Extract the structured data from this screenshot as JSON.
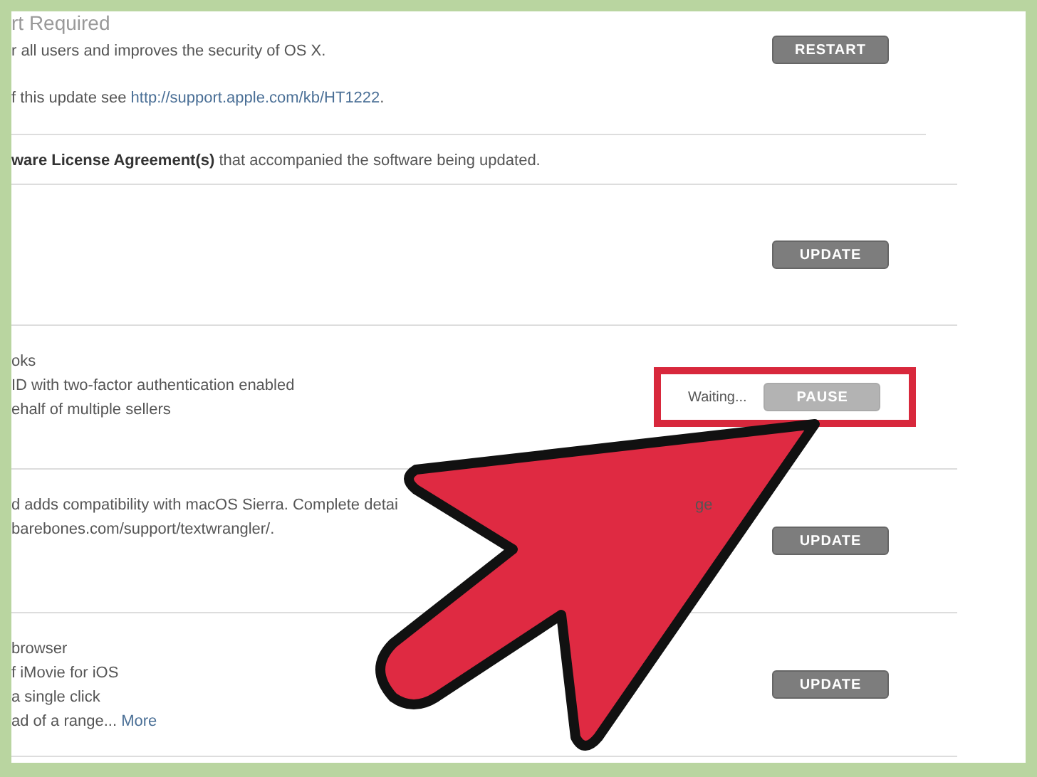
{
  "sections": [
    {
      "title": "rt Required",
      "lines": [
        [
          {
            "text": "r all users and improves the security of OS X."
          }
        ],
        [
          {
            "text": "f this update see "
          },
          {
            "text": "http://support.apple.com/kb/HT1222",
            "kind": "link"
          },
          {
            "text": "."
          }
        ]
      ],
      "note": "**ware License Agreement(s)** that accompanied the software being updated.",
      "button": {
        "label": "RESTART",
        "disabled": false
      }
    },
    {
      "button": {
        "label": "UPDATE",
        "disabled": false
      }
    },
    {
      "lines": [
        [
          {
            "text": "oks"
          }
        ],
        [
          {
            "text": "ID with two-factor authentication enabled"
          }
        ],
        [
          {
            "text": "ehalf of multiple sellers"
          }
        ]
      ],
      "status": "Waiting...",
      "highlighted": true,
      "button": {
        "label": "PAUSE",
        "disabled": true
      }
    },
    {
      "lines": [
        [
          {
            "text": "d adds compatibility with macOS Sierra. Complete detai"
          }
        ],
        [
          {
            "text": "barebones.com/support/textwrangler/."
          }
        ]
      ],
      "side_fragment": "ge",
      "button": {
        "label": "UPDATE",
        "disabled": false
      }
    },
    {
      "lines": [
        [
          {
            "text": "browser"
          }
        ],
        [
          {
            "text": "f iMovie for iOS"
          }
        ],
        [
          {
            "text": "a single click"
          }
        ],
        [
          {
            "text": "ad of a range... "
          },
          {
            "text": "More",
            "kind": "link"
          }
        ]
      ],
      "button": {
        "label": "UPDATE",
        "disabled": false
      }
    }
  ]
}
